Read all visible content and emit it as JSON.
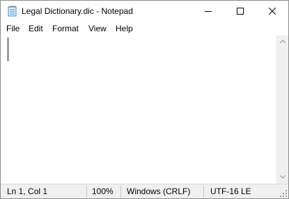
{
  "window": {
    "title": "Legal Dictionary.dic - Notepad"
  },
  "icons": {
    "app": "notepad-icon",
    "minimize": "minimize-icon",
    "maximize": "maximize-icon",
    "close": "close-icon"
  },
  "menu": [
    "File",
    "Edit",
    "Format",
    "View",
    "Help"
  ],
  "editor": {
    "content": ""
  },
  "status": {
    "position": "Ln 1, Col 1",
    "zoom": "100%",
    "line_ending": "Windows (CRLF)",
    "encoding": "UTF-16 LE"
  }
}
